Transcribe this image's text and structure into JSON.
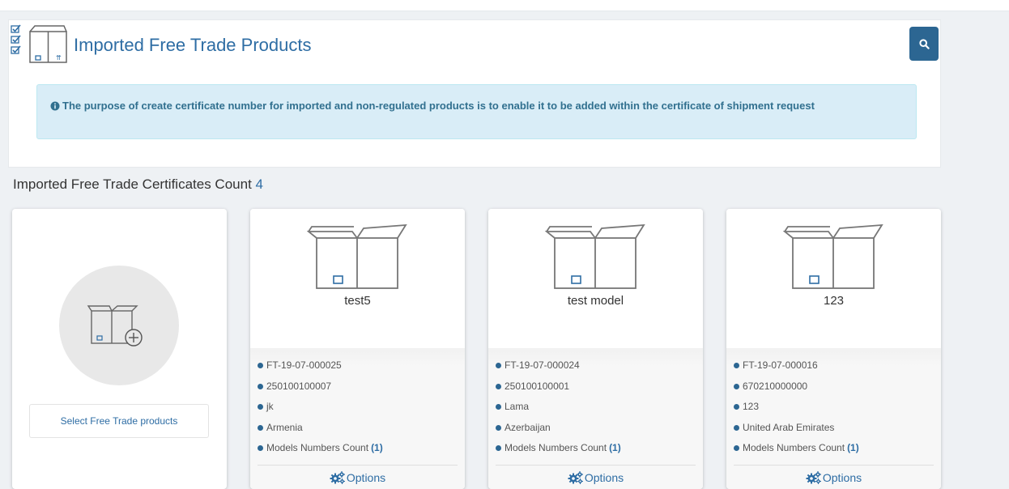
{
  "header": {
    "title": "Imported Free Trade Products",
    "search_icon": "search-icon",
    "title_icon": "box-with-checklist-icon"
  },
  "alert": {
    "icon": "info-circle-icon",
    "text": "The purpose of create certificate number for imported and non-regulated products is to enable it to be added within the certificate of shipment request"
  },
  "count": {
    "label": "Imported Free Trade Certificates Count",
    "value": "4"
  },
  "add_card": {
    "icon": "box-plus-icon",
    "button_label": "Select Free Trade products"
  },
  "cards": [
    {
      "name": "test5",
      "certificate": "FT-19-07-000025",
      "code": "250100100007",
      "description": "jk",
      "country": "Armenia",
      "models_label": "Models Numbers Count",
      "models_count": "(1)",
      "options_label": "Options"
    },
    {
      "name": "test model",
      "certificate": "FT-19-07-000024",
      "code": "250100100001",
      "description": "Lama",
      "country": "Azerbaijan",
      "models_label": "Models Numbers Count",
      "models_count": "(1)",
      "options_label": "Options"
    },
    {
      "name": "123",
      "certificate": "FT-19-07-000016",
      "code": "670210000000",
      "description": "123",
      "country": "United Arab Emirates",
      "models_label": "Models Numbers Count",
      "models_count": "(1)",
      "options_label": "Options"
    }
  ],
  "colors": {
    "accent": "#2e6da4",
    "button": "#2c6692",
    "alert_bg": "#d9edf7",
    "alert_text": "#31708f"
  }
}
